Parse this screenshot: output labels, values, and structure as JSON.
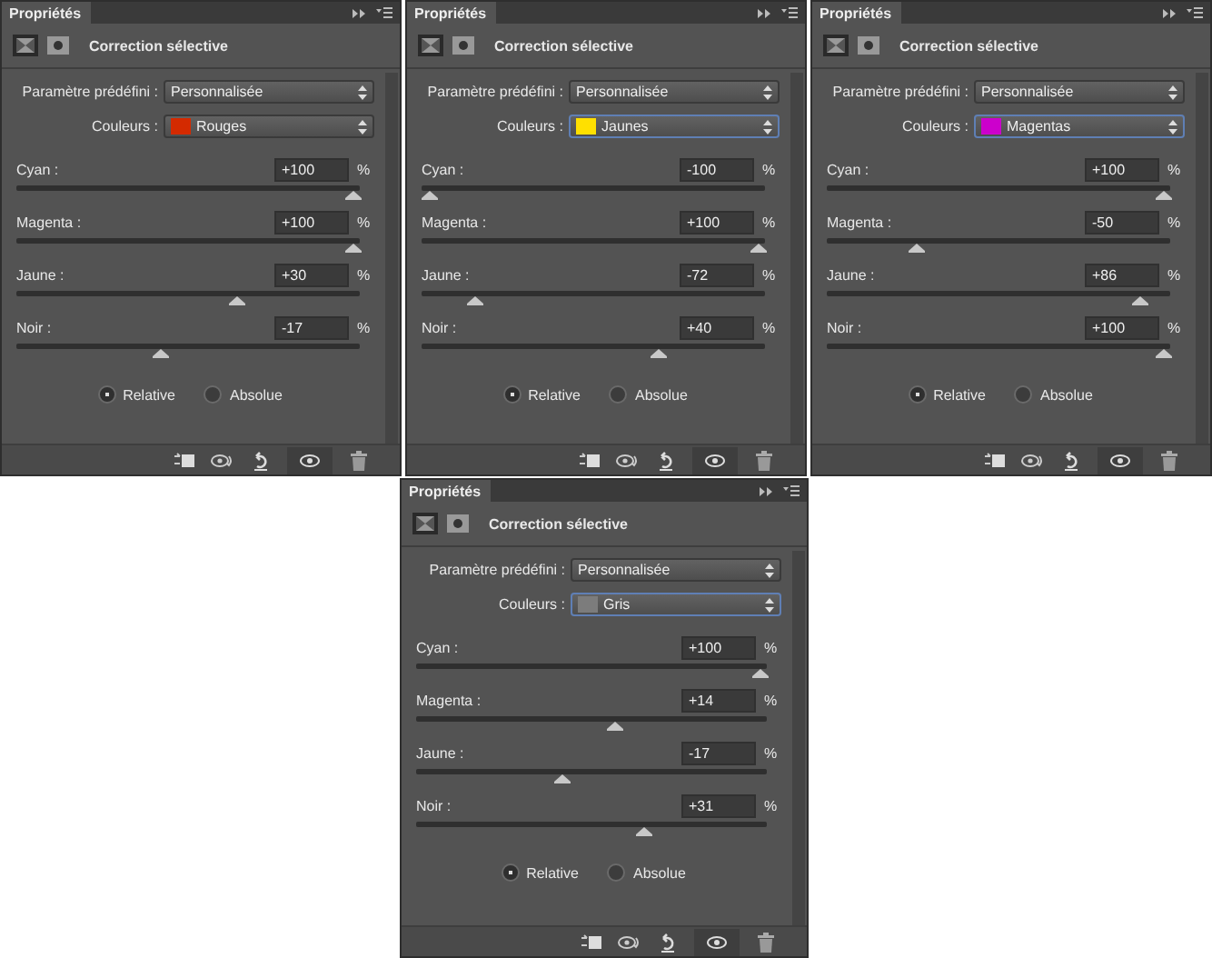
{
  "panels": [
    {
      "tab": "Propriétés",
      "title": "Correction sélective",
      "preset": {
        "label": "Paramètre prédéfini :",
        "value": "Personnalisée"
      },
      "colors": {
        "label": "Couleurs :",
        "value": "Rouges",
        "color": "#d42a00",
        "focused": false
      },
      "sliders": [
        {
          "name": "Cyan :",
          "value": "+100",
          "unit": "%",
          "level": 1
        },
        {
          "name": "Magenta :",
          "value": "+100",
          "unit": "%",
          "level": 1
        },
        {
          "name": "Jaune :",
          "value": "+30",
          "unit": "%",
          "level": 0.65
        },
        {
          "name": "Noir :",
          "value": "-17",
          "unit": "%",
          "level": 0.415
        }
      ],
      "modes": [
        {
          "label": "Relative",
          "selected": true
        },
        {
          "label": "Absolue",
          "selected": false
        }
      ]
    },
    {
      "tab": "Propriétés",
      "title": "Correction sélective",
      "preset": {
        "label": "Paramètre prédéfini :",
        "value": "Personnalisée"
      },
      "colors": {
        "label": "Couleurs :",
        "value": "Jaunes",
        "color": "#ffe000",
        "focused": true
      },
      "sliders": [
        {
          "name": "Cyan :",
          "value": "-100",
          "unit": "%",
          "level": 0
        },
        {
          "name": "Magenta :",
          "value": "+100",
          "unit": "%",
          "level": 1
        },
        {
          "name": "Jaune :",
          "value": "-72",
          "unit": "%",
          "level": 0.14
        },
        {
          "name": "Noir :",
          "value": "+40",
          "unit": "%",
          "level": 0.7
        }
      ],
      "modes": [
        {
          "label": "Relative",
          "selected": true
        },
        {
          "label": "Absolue",
          "selected": false
        }
      ]
    },
    {
      "tab": "Propriétés",
      "title": "Correction sélective",
      "preset": {
        "label": "Paramètre prédéfini :",
        "value": "Personnalisée"
      },
      "colors": {
        "label": "Couleurs :",
        "value": "Magentas",
        "color": "#cc00cc",
        "focused": true
      },
      "sliders": [
        {
          "name": "Cyan :",
          "value": "+100",
          "unit": "%",
          "level": 1
        },
        {
          "name": "Magenta :",
          "value": "-50",
          "unit": "%",
          "level": 0.25
        },
        {
          "name": "Jaune :",
          "value": "+86",
          "unit": "%",
          "level": 0.93
        },
        {
          "name": "Noir :",
          "value": "+100",
          "unit": "%",
          "level": 1
        }
      ],
      "modes": [
        {
          "label": "Relative",
          "selected": true
        },
        {
          "label": "Absolue",
          "selected": false
        }
      ]
    },
    {
      "tab": "Propriétés",
      "title": "Correction sélective",
      "preset": {
        "label": "Paramètre prédéfini :",
        "value": "Personnalisée"
      },
      "colors": {
        "label": "Couleurs :",
        "value": "Gris",
        "color": "#7c7c7c",
        "focused": true
      },
      "sliders": [
        {
          "name": "Cyan :",
          "value": "+100",
          "unit": "%",
          "level": 1
        },
        {
          "name": "Magenta :",
          "value": "+14",
          "unit": "%",
          "level": 0.57
        },
        {
          "name": "Jaune :",
          "value": "-17",
          "unit": "%",
          "level": 0.415
        },
        {
          "name": "Noir :",
          "value": "+31",
          "unit": "%",
          "level": 0.655
        }
      ],
      "modes": [
        {
          "label": "Relative",
          "selected": true
        },
        {
          "label": "Absolue",
          "selected": false
        }
      ]
    }
  ]
}
